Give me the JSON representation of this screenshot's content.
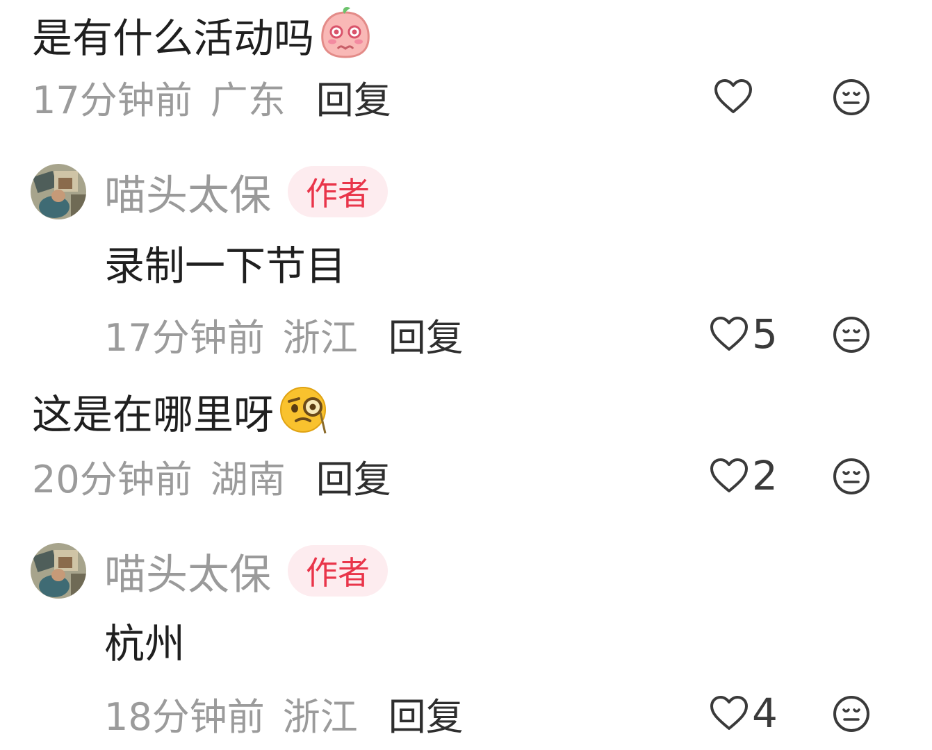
{
  "comments": [
    {
      "text": "是有什么活动吗",
      "emoji": "pleading-peach-emoji",
      "time": "17分钟前",
      "location": "广东",
      "reply_label": "回复",
      "likes": ""
    },
    {
      "author": "喵头太保",
      "badge": "作者",
      "text": "录制一下节目",
      "time": "17分钟前",
      "location": "浙江",
      "reply_label": "回复",
      "likes": "5"
    },
    {
      "text": "这是在哪里呀",
      "emoji": "monocle-face-emoji",
      "time": "20分钟前",
      "location": "湖南",
      "reply_label": "回复",
      "likes": "2"
    },
    {
      "author": "喵头太保",
      "badge": "作者",
      "text": "杭州",
      "time": "18分钟前",
      "location": "浙江",
      "reply_label": "回复",
      "likes": "4"
    }
  ],
  "icons": {
    "like": "heart-outline-icon",
    "dislike": "neutral-face-icon"
  },
  "colors": {
    "text": "#1f1f1f",
    "meta": "#9b9b9b",
    "badge_text": "#e9354a",
    "badge_bg": "#fdecef"
  }
}
